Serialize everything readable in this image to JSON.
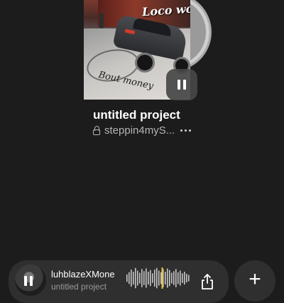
{
  "album": {
    "art_title_text": "Loco world",
    "art_caption_text": "Bout money",
    "pause_icon": "pause-icon"
  },
  "track": {
    "title": "untitled project",
    "artist": "steppin4myS...",
    "lock_icon": "lock-icon",
    "more_icon": "more-horizontal-icon"
  },
  "mini_player": {
    "title": "luhblazeXMone",
    "subtitle": "untitled project",
    "pause_icon": "pause-icon",
    "share_icon": "share-icon",
    "waveform_playhead_fraction": 0.55
  },
  "add_button": {
    "label": "+",
    "icon": "plus-icon"
  },
  "colors": {
    "background": "#1c1c1c",
    "panel": "#2f2f2f",
    "waveform_bars": "#c8c8c8",
    "playhead": "#f2c230"
  }
}
